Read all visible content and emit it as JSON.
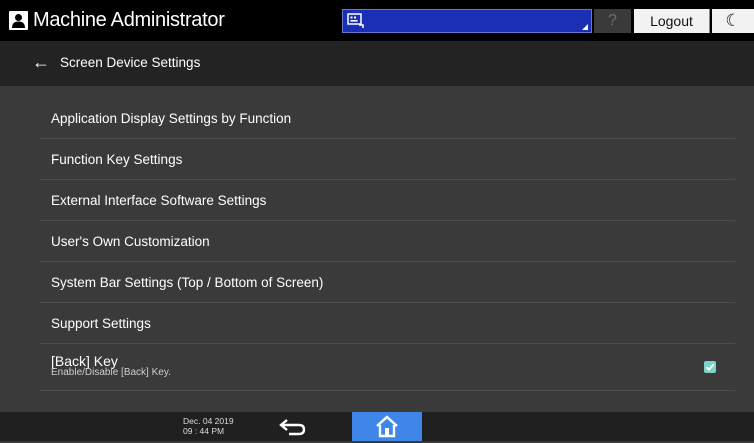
{
  "header": {
    "user_name": "Machine Administrator",
    "help_label": "?",
    "logout_label": "Logout",
    "energy_saver_symbol": "☾",
    "input_accent": "#1a2fb4"
  },
  "titlebar": {
    "back_symbol": "←",
    "title": "Screen Device Settings"
  },
  "items": [
    {
      "label": "Application Display Settings by Function"
    },
    {
      "label": "Function Key Settings"
    },
    {
      "label": "External Interface Software Settings"
    },
    {
      "label": "User's Own Customization"
    },
    {
      "label": "System Bar Settings (Top / Bottom of Screen)"
    },
    {
      "label": "Support Settings"
    },
    {
      "label": "[Back] Key",
      "sub": "Enable/Disable [Back] Key.",
      "checked": true
    }
  ],
  "footer": {
    "date": "Dec. 04 2019",
    "time": "09 : 44 PM",
    "home_color": "#3e86e8"
  },
  "icons": {
    "user": "user-icon",
    "keyboard": "keyboard-icon",
    "back": "back-arrow-icon",
    "home": "home-icon",
    "moon": "moon-icon"
  }
}
